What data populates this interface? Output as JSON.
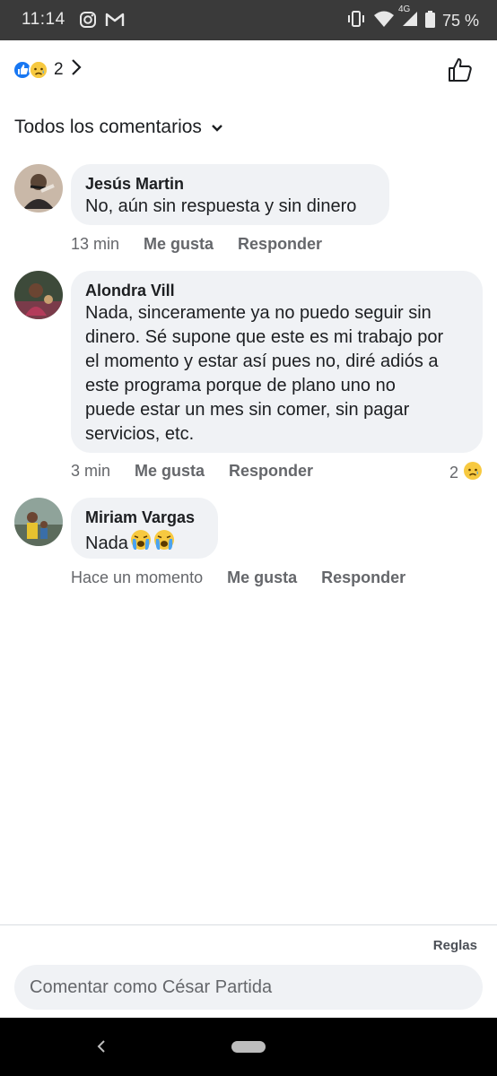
{
  "status_bar": {
    "time": "11:14",
    "battery": "75 %",
    "network": "4G"
  },
  "reactions": {
    "count": "2"
  },
  "filter": {
    "label": "Todos los comentarios"
  },
  "comments": [
    {
      "author": "Jesús Martin",
      "lines": [
        "No, aún sin respuesta y sin dinero"
      ],
      "time": "13 min",
      "like": "Me gusta",
      "reply": "Responder",
      "reaction_count": ""
    },
    {
      "author": "Alondra Vill",
      "lines": [
        "Nada, sinceramente ya no puedo seguir sin",
        "dinero. Sé supone que este es mi trabajo por",
        "el momento y estar así pues no, diré adiós a",
        "este programa porque de plano uno no",
        "puede estar un mes sin comer, sin pagar",
        "servicios, etc."
      ],
      "time": "3 min",
      "like": "Me gusta",
      "reply": "Responder",
      "reaction_count": "2"
    },
    {
      "author": "Miriam Vargas",
      "lines": [
        "Nada"
      ],
      "time": "Hace un momento",
      "like": "Me gusta",
      "reply": "Responder",
      "reaction_count": ""
    }
  ],
  "footer": {
    "rules": "Reglas",
    "placeholder": "Comentar como César Partida"
  },
  "colors": {
    "brand": "#1877f2",
    "bubble": "#f0f2f5",
    "meta": "#65676b",
    "text": "#1c1e21"
  },
  "icons": [
    "instagram-icon",
    "gmail-icon",
    "vibrate-icon",
    "wifi-icon",
    "signal-icon",
    "battery-icon",
    "like-reaction-icon",
    "sad-reaction-icon",
    "chevron-right-icon",
    "thumbs-up-outline-icon",
    "chevron-down-icon",
    "crying-emoji-icon",
    "back-icon",
    "home-pill-icon"
  ]
}
